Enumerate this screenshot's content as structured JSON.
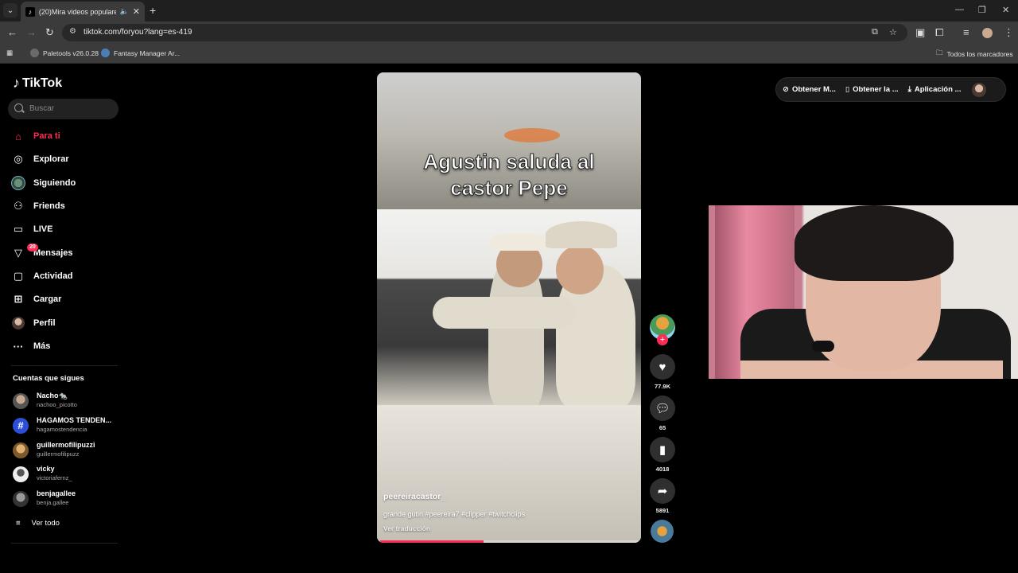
{
  "browser": {
    "tab_title": "(20)Mira videos populares",
    "tab_favicon": "tiktok-icon",
    "url": "tiktok.com/foryou?lang=es-419",
    "bookmarks": [
      {
        "label": "Paletools v26.0.28"
      },
      {
        "label": "Fantasy Manager Ar..."
      }
    ],
    "all_bookmarks_label": "Todos los marcadores"
  },
  "sidebar": {
    "logo_text": "TikTok",
    "search_placeholder": "Buscar",
    "nav": [
      {
        "label": "Para ti",
        "icon": "home-icon",
        "active": true
      },
      {
        "label": "Explorar",
        "icon": "compass-icon"
      },
      {
        "label": "Siguiendo",
        "icon": "following-avatar-icon"
      },
      {
        "label": "Friends",
        "icon": "friends-icon"
      },
      {
        "label": "LIVE",
        "icon": "live-icon"
      },
      {
        "label": "Mensajes",
        "icon": "messages-icon",
        "badge": "20"
      },
      {
        "label": "Actividad",
        "icon": "activity-icon"
      },
      {
        "label": "Cargar",
        "icon": "upload-icon"
      },
      {
        "label": "Perfil",
        "icon": "profile-avatar-icon"
      },
      {
        "label": "Más",
        "icon": "more-icon"
      }
    ],
    "following_heading": "Cuentas que sigues",
    "following": [
      {
        "name": "Nacho🐀",
        "handle": "nachoo_picotto"
      },
      {
        "name": "HAGAMOS TENDEN...",
        "handle": "hagamostendencia"
      },
      {
        "name": "guillermofilipuzzi",
        "handle": "guillermofilipuzz"
      },
      {
        "name": "vicky",
        "handle": "victoriafernz_"
      },
      {
        "name": "benjagallee",
        "handle": "benja.gallee"
      }
    ],
    "see_all": "Ver todo"
  },
  "video": {
    "caption_overlay": "Agustin saluda al castor Pepe",
    "username": "peereiracastor_",
    "description": "grande gutin #peereira7 #clipper #twitchclips",
    "translate_label": "Ver traducción",
    "progress": 0.4
  },
  "actions": {
    "likes": "77.9K",
    "comments": "65",
    "saves": "4018",
    "shares": "5891"
  },
  "topright": {
    "coins_label": "Obtener M...",
    "app_label": "Obtener la ...",
    "desktop_label": "Aplicación ..."
  },
  "colors": {
    "accent": "#fe2c55",
    "background": "#000000"
  }
}
